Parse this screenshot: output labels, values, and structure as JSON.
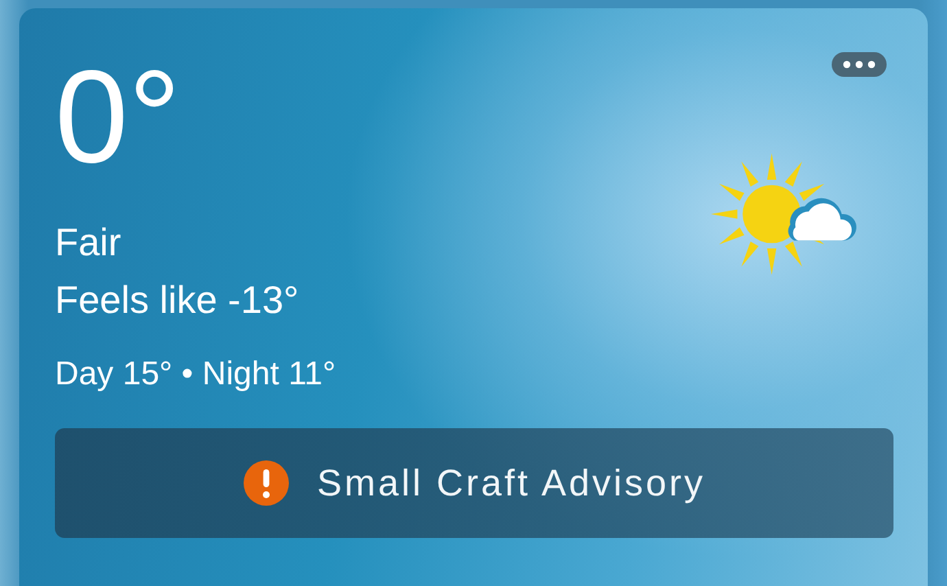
{
  "temperature": "0°",
  "condition": "Fair",
  "feels_like": "Feels like -13°",
  "day_night": "Day 15° • Night 11°",
  "alert": {
    "kind": "warning",
    "text": "Small Craft Advisory"
  }
}
